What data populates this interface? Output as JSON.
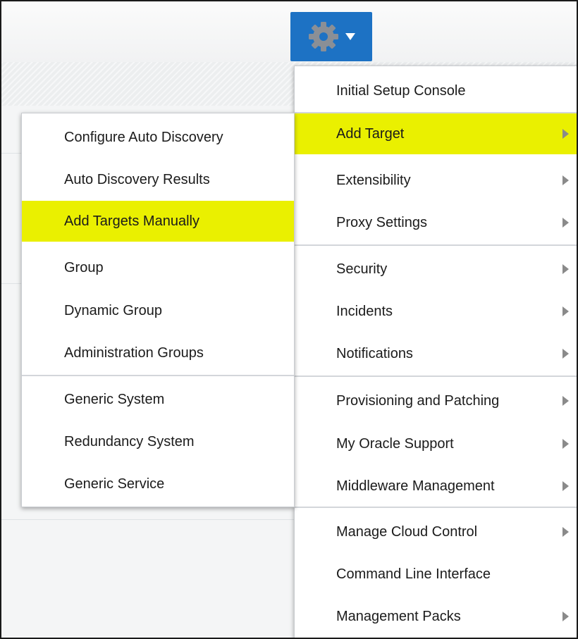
{
  "toolbar": {
    "settings_icon": "gear-icon",
    "dropdown_icon": "caret-down-icon",
    "accent_color": "#1d72c4"
  },
  "highlight_color": "#eaf000",
  "main_menu": {
    "items": [
      {
        "label": "Initial Setup Console"
      },
      {
        "label": "Add Target"
      },
      {
        "label": "Extensibility"
      },
      {
        "label": "Proxy Settings"
      },
      {
        "label": "Security"
      },
      {
        "label": "Incidents"
      },
      {
        "label": "Notifications"
      },
      {
        "label": "Provisioning and Patching"
      },
      {
        "label": "My Oracle Support"
      },
      {
        "label": "Middleware Management"
      },
      {
        "label": "Manage Cloud Control"
      },
      {
        "label": "Command Line Interface"
      },
      {
        "label": "Management Packs"
      }
    ]
  },
  "sub_menu": {
    "items": [
      {
        "label": "Configure Auto Discovery"
      },
      {
        "label": "Auto Discovery Results"
      },
      {
        "label": "Add Targets Manually"
      },
      {
        "label": "Group"
      },
      {
        "label": "Dynamic Group"
      },
      {
        "label": "Administration Groups"
      },
      {
        "label": "Generic System"
      },
      {
        "label": "Redundancy System"
      },
      {
        "label": "Generic Service"
      }
    ]
  }
}
